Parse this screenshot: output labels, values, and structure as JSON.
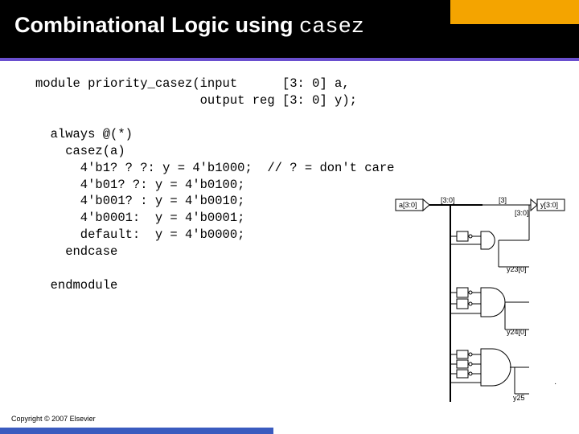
{
  "title_part1": "Combinational Logic using ",
  "title_part2": "casez",
  "code": "module priority_casez(input      [3: 0] a,\n                      output reg [3: 0] y);\n\n  always @(*)\n    casez(a)\n      4'b1? ? ?: y = 4'b1000;  // ? = don't care\n      4'b01? ?: y = 4'b0100;\n      4'b001? : y = 4'b0010;\n      4'b0001:  y = 4'b0001;\n      default:  y = 4'b0000;\n    endcase\n\n  endmodule",
  "copyright": "Copyright © 2007 Elsevier",
  "diagram": {
    "input_label": "a[3:0]",
    "bus_label": "[3:0]",
    "bit3": "[3]",
    "out_top": "y[3:0]",
    "out_bus": "[3:0]",
    "y23": "y23[0]",
    "y24": "y24[0]",
    "y25": "y25"
  },
  "dot": "."
}
